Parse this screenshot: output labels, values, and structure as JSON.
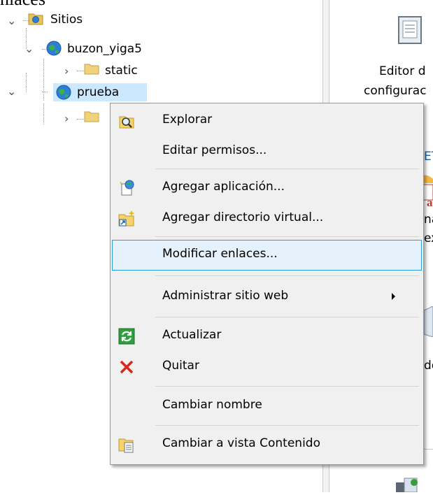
{
  "window": {
    "title_fragment": "nlaces"
  },
  "tree": {
    "root": {
      "label": "Sitios"
    },
    "sites": [
      {
        "label": "buzon_yiga5",
        "children": [
          {
            "label": "static"
          }
        ]
      },
      {
        "label": "prueba"
      }
    ]
  },
  "right_pane": {
    "editor_line1": "Editor d",
    "editor_line2": "configurac",
    "net_fragment": "ET",
    "ab_badge": "ab",
    "frag_1": "nas",
    "frag_2": "exio",
    "frag_3": "de"
  },
  "context_menu": {
    "items": [
      {
        "label": "Explorar",
        "icon": "explore-icon"
      },
      {
        "label": "Editar permisos..."
      },
      {
        "label": "Agregar aplicación...",
        "icon": "add-application-icon"
      },
      {
        "label": "Agregar directorio virtual...",
        "icon": "add-virtual-directory-icon"
      },
      {
        "label": "Modificar enlaces...",
        "highlighted": true
      },
      {
        "label": "Administrar sitio web",
        "submenu": true
      },
      {
        "label": "Actualizar",
        "icon": "refresh-icon"
      },
      {
        "label": "Quitar",
        "icon": "remove-icon"
      },
      {
        "label": "Cambiar nombre"
      },
      {
        "label": "Cambiar a vista Contenido",
        "icon": "content-view-icon"
      }
    ]
  },
  "colors": {
    "highlight_bg": "#e5f1fb",
    "highlight_border": "#26a0da",
    "tree_selection": "#cce8ff",
    "menu_bg": "#f0f0f0"
  }
}
